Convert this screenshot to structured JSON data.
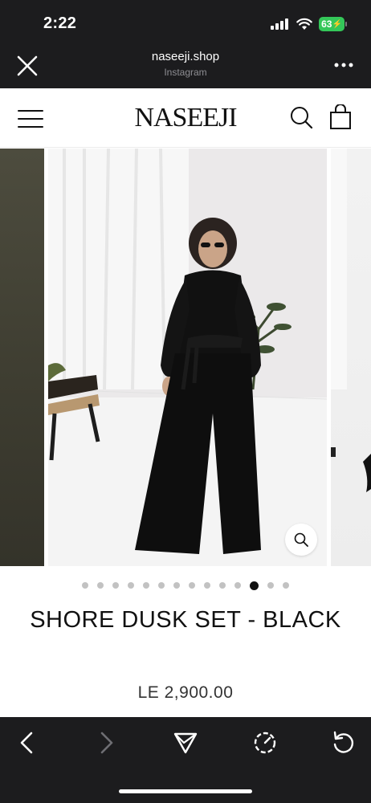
{
  "status_bar": {
    "time": "2:22",
    "battery": "63"
  },
  "browser": {
    "domain": "naseeji.shop",
    "source": "Instagram"
  },
  "site": {
    "logo": "NASEEJI",
    "gallery": {
      "dot_count": 14,
      "active_index": 11
    },
    "product": {
      "title": "SHORE DUSK SET - BLACK",
      "price": "LE 2,900.00"
    }
  },
  "colors": {
    "battery_green": "#34c759",
    "browser_chrome": "#1c1c1e"
  },
  "icons": [
    "close-icon",
    "more-icon",
    "menu-icon",
    "search-icon",
    "bag-icon",
    "zoom-icon",
    "back-icon",
    "forward-icon",
    "share-icon",
    "speed-icon",
    "reload-icon"
  ]
}
